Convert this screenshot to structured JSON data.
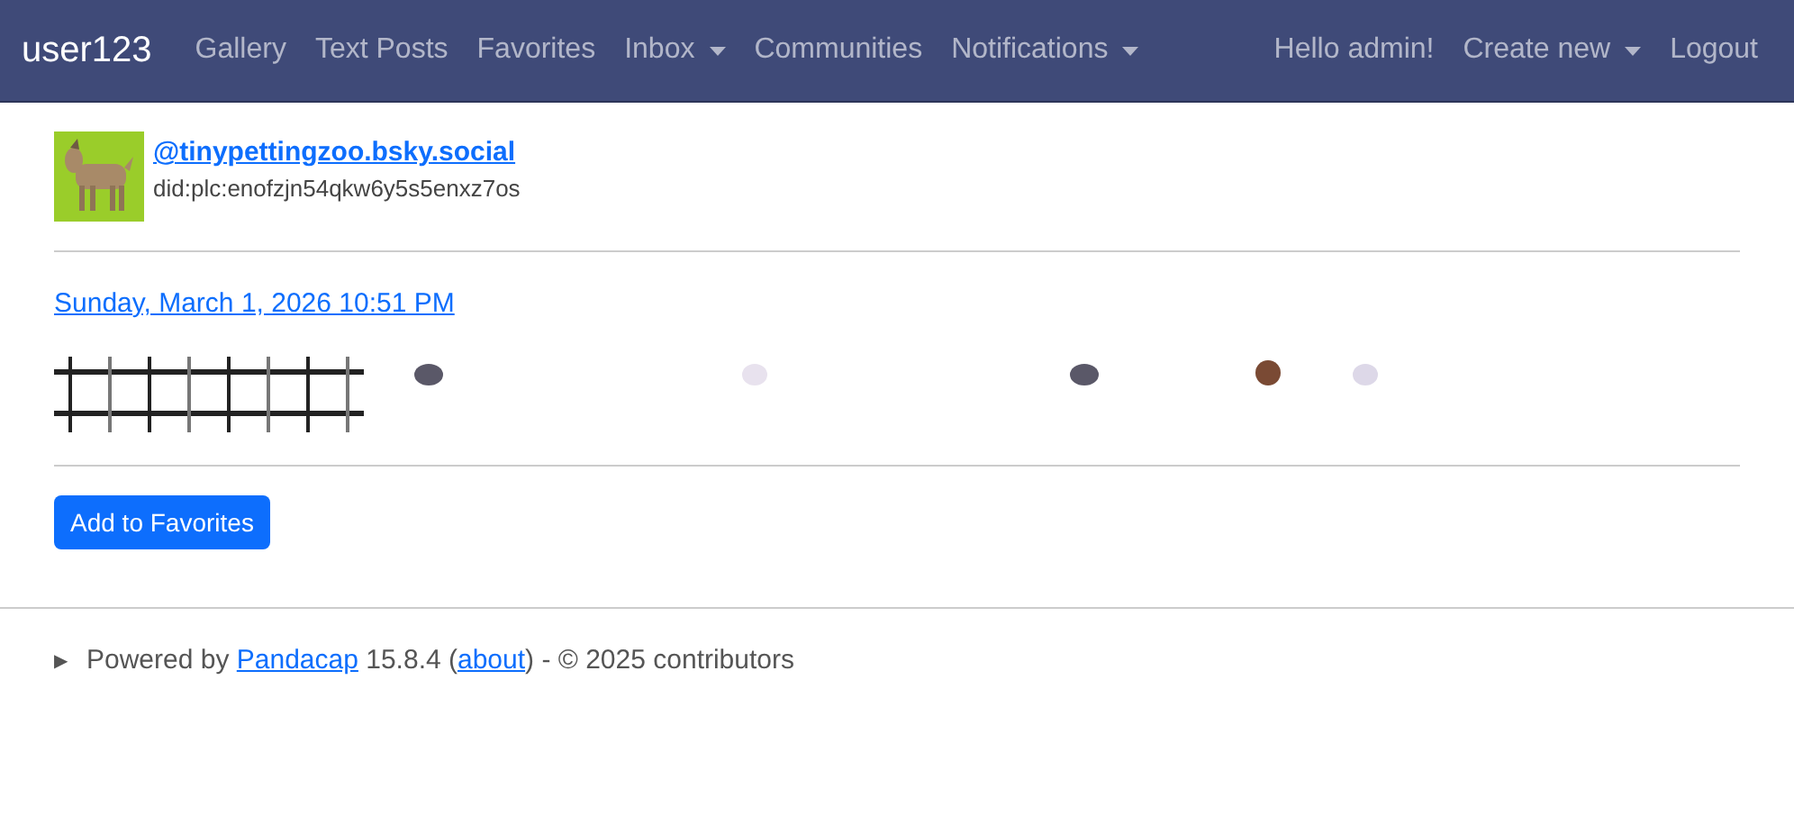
{
  "navbar": {
    "brand": "user123",
    "left": [
      {
        "label": "Gallery",
        "kind": "link"
      },
      {
        "label": "Text Posts",
        "kind": "link"
      },
      {
        "label": "Favorites",
        "kind": "link"
      },
      {
        "label": "Inbox",
        "kind": "dropdown"
      },
      {
        "label": "Communities",
        "kind": "link"
      },
      {
        "label": "Notifications",
        "kind": "dropdown"
      }
    ],
    "right": [
      {
        "label": "Hello admin!",
        "kind": "text"
      },
      {
        "label": "Create new",
        "kind": "dropdown"
      },
      {
        "label": "Logout",
        "kind": "link"
      }
    ]
  },
  "post": {
    "author": {
      "handle": "@tinypettingzoo.bsky.social",
      "did": "did:plc:enofzjn54qkw6y5s5enxz7os"
    },
    "date": "Sunday, March 1, 2026 10:51 PM",
    "button": "Add to Favorites"
  },
  "footer": {
    "toggle": "▶",
    "prefix": "Powered by ",
    "link": "Pandacap",
    "middle": " 15.8.4 (",
    "about": "about",
    "suffix": ") - © 2025 contributors"
  }
}
